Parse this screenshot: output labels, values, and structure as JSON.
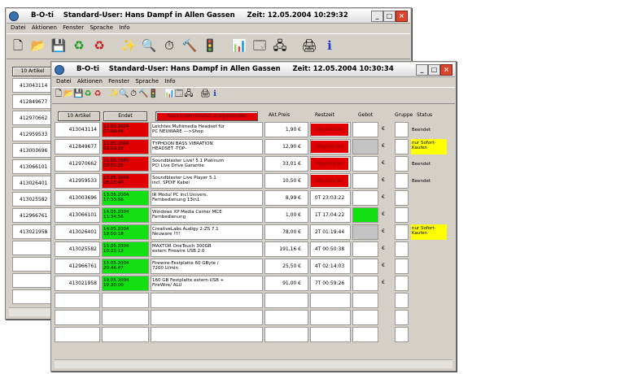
{
  "back_window": {
    "title": "B-O-ti    Standard-User: Hans Dampf in Allen Gassen     Zeit: 12.05.2004 10:29:32",
    "menu": [
      "Datei",
      "Aktionen",
      "Fenster",
      "Sprache",
      "Info"
    ],
    "first_button": "10 Artikel",
    "ids": [
      "413043114",
      "412849677",
      "412970662",
      "412959533",
      "413003696",
      "413066101",
      "413026401",
      "413025582",
      "412966761",
      "413021958"
    ]
  },
  "front_window": {
    "title": "B-O-ti    Standard-User: Hans Dampf in Allen Gassen     Zeit: 12.05.2004 10:30:34",
    "menu": [
      "Datei",
      "Aktionen",
      "Fenster",
      "Sprache",
      "Info"
    ],
    "buttons": {
      "articles": "10 Artikel",
      "end": "Endet",
      "filter": "Auktionsende/Zeit ausgeblendet"
    },
    "columns": [
      "Akt.Preis",
      "Restzeit",
      "Gebot",
      "Gruppe",
      "Status"
    ],
    "rows": [
      {
        "id": "413043114",
        "date": "11.05.2004",
        "time": "07:49:44",
        "title1": "Leichtes Multimedia Headset für",
        "title2": "PC NEUWARE --->Shop",
        "price": "1,90 €",
        "rest": "Abgelaufen",
        "bid": "",
        "bid_color": "white",
        "group": "€",
        "status": "Beendet",
        "status_color": "none",
        "date_color": "red",
        "rest_color": "red"
      },
      {
        "id": "412849677",
        "date": "11.05.2004",
        "time": "08:10:25",
        "title1": "TYPHOON BASS VIBRATION",
        "title2": "HEADSET -TOP-",
        "price": "12,90 €",
        "rest": "Abgelaufen",
        "bid": "",
        "bid_color": "grey",
        "group": "€",
        "status": "nur Sofort-Kaufen",
        "status_color": "yellow",
        "date_color": "red",
        "rest_color": "red"
      },
      {
        "id": "412970662",
        "date": "11.05.2004",
        "time": "08:51:35",
        "title1": "Soundblaster Live! 5.1 Platinum",
        "title2": "PCI Live Drive Garantie",
        "price": "33,01 €",
        "rest": "Abgelaufen",
        "bid": "",
        "bid_color": "white",
        "group": "€",
        "status": "Beendet",
        "status_color": "none",
        "date_color": "red",
        "rest_color": "red"
      },
      {
        "id": "412959533",
        "date": "12.05.2004",
        "time": "08:27:49",
        "title1": "Soundblaster Live Player 5.1",
        "title2": "incl. SPDIF Kabel",
        "price": "10,50 €",
        "rest": "Abgelaufen",
        "bid": "",
        "bid_color": "white",
        "group": "€",
        "status": "Beendet",
        "status_color": "none",
        "date_color": "red",
        "rest_color": "red"
      },
      {
        "id": "413003696",
        "date": "13.05.2004",
        "time": "17:33:56",
        "title1": "IR Modul PC incl.Univers.",
        "title2": "Fernbedienung 13in1",
        "price": "8,99 €",
        "rest": "0T 23:03:22",
        "bid": "",
        "bid_color": "white",
        "group": "€",
        "status": "",
        "status_color": "none",
        "date_color": "green",
        "rest_color": "none"
      },
      {
        "id": "413066101",
        "date": "14.05.2004",
        "time": "11:34:56",
        "title1": "Windows XP Media Center MCE",
        "title2": "Fernbedienung",
        "price": "1,00 €",
        "rest": "1T 17:04:22",
        "bid": "",
        "bid_color": "green",
        "group": "€",
        "status": "",
        "status_color": "none",
        "date_color": "green",
        "rest_color": "none"
      },
      {
        "id": "413026401",
        "date": "14.05.2004",
        "time": "19:50:18",
        "title1": "CreativeLabs Audigy 2-ZS 7.1",
        "title2": "Neuware !!!!",
        "price": "78,00 €",
        "rest": "2T 01:19:44",
        "bid": "",
        "bid_color": "grey",
        "group": "€",
        "status": "nur Sofort-Kaufen",
        "status_color": "yellow",
        "date_color": "green",
        "rest_color": "none"
      },
      {
        "id": "413025582",
        "date": "15.05.2004",
        "time": "10:21:12",
        "title1": "MAXTOR OneTouch 300GB",
        "title2": "extern Firewire USB 2.0",
        "price": "191,16 €",
        "rest": "4T 00:50:38",
        "bid": "",
        "bid_color": "white",
        "group": "€",
        "status": "",
        "status_color": "none",
        "date_color": "green",
        "rest_color": "none"
      },
      {
        "id": "412966761",
        "date": "15.05.2004",
        "time": "20:44:47",
        "title1": "Firewire-Festplatte 60 GByte /",
        "title2": "7200 U/min",
        "price": "25,50 €",
        "rest": "4T 02:14:03",
        "bid": "",
        "bid_color": "white",
        "group": "€",
        "status": "",
        "status_color": "none",
        "date_color": "green",
        "rest_color": "none"
      },
      {
        "id": "413021958",
        "date": "19.05.2004",
        "time": "19:30:00",
        "title1": "160 GB Festplatte extern USB +",
        "title2": "FireWire/ ALU",
        "price": "91,00 €",
        "rest": "7T 00:59:26",
        "bid": "",
        "bid_color": "white",
        "group": "€",
        "status": "",
        "status_color": "none",
        "date_color": "green",
        "rest_color": "none"
      }
    ],
    "empty_rows": 3
  },
  "colors": {
    "red": "#e00000",
    "green": "#12e012",
    "yellow": "#ffff00",
    "window_bg": "#d4d0c8"
  }
}
